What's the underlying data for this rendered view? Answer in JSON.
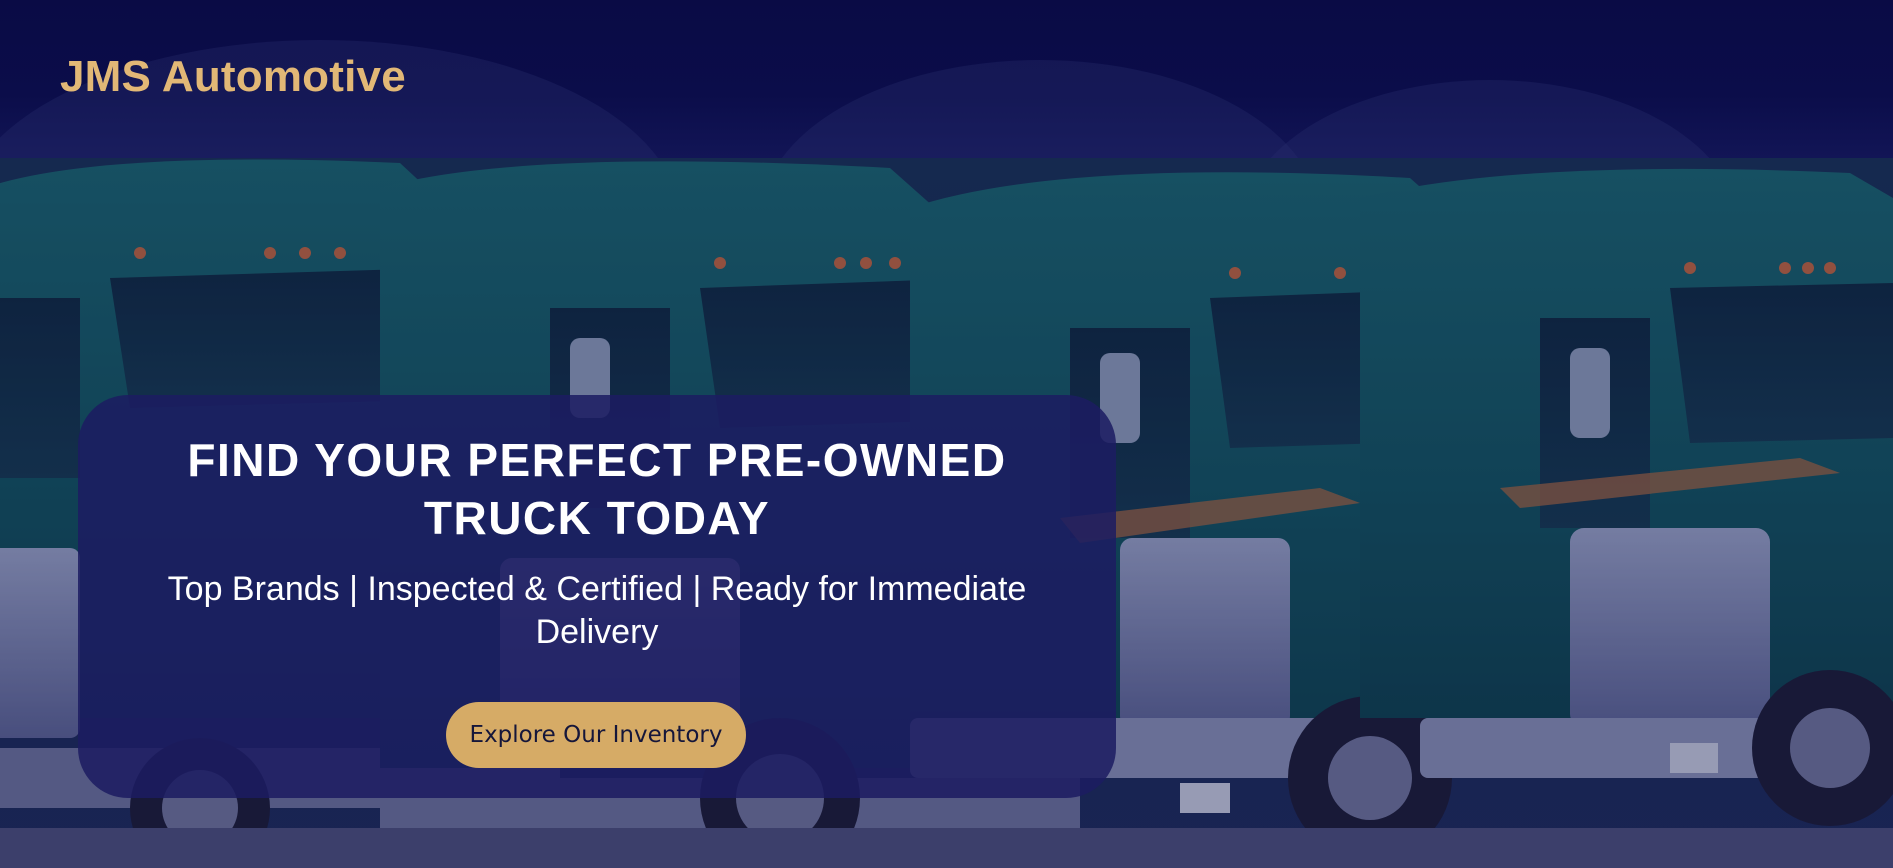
{
  "header": {
    "logo_text": "JMS Automotive"
  },
  "hero": {
    "headline": "FIND YOUR PERFECT PRE-OWNED TRUCK TODAY",
    "subheadline": "Top Brands | Inspected & Certified | Ready for Immediate Delivery",
    "cta_label": "Explore Our Inventory",
    "background_image": "row-of-teal-semi-trucks"
  },
  "colors": {
    "header_bg": "#0a0b45",
    "logo": "#e2b876",
    "card_bg": "#1c1c62",
    "cta_bg": "#d6ab66",
    "cta_text": "#15163a",
    "truck_body": "#0f5458"
  }
}
